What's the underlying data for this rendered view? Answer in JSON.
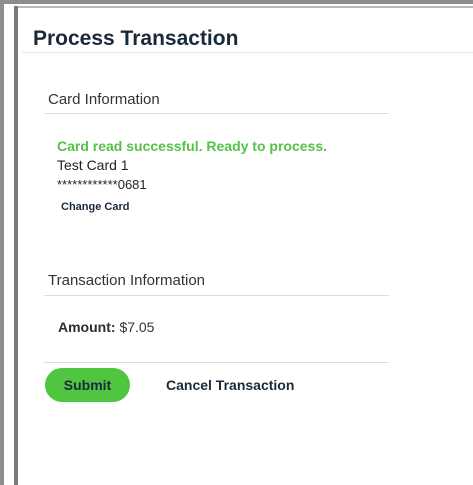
{
  "page": {
    "title": "Process Transaction"
  },
  "card_section": {
    "heading": "Card Information",
    "status": "Card read successful. Ready to process.",
    "card_name": "Test Card 1",
    "card_number": "************0681",
    "change_card_label": "Change Card"
  },
  "transaction_section": {
    "heading": "Transaction Information",
    "amount_label": "Amount:",
    "amount_value": "$7.05"
  },
  "actions": {
    "submit_label": "Submit",
    "cancel_label": "Cancel Transaction"
  },
  "colors": {
    "accent_green": "#4fc540",
    "status_green": "#53c247",
    "title_navy": "#1b2a3b"
  }
}
